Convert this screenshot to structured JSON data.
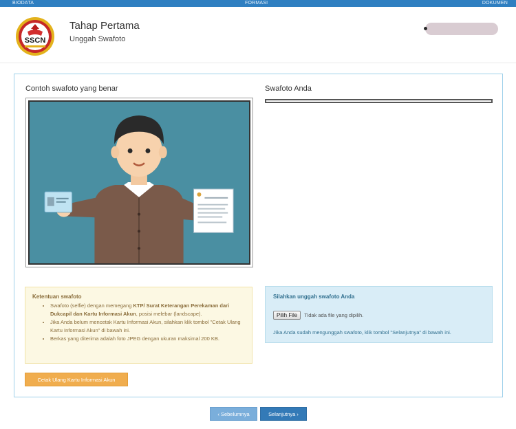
{
  "steps": [
    "BIODATA",
    "FORMASI",
    "DOKUMEN"
  ],
  "header": {
    "logo_text": "SSCN",
    "title": "Tahap Pertama",
    "subtitle": "Unggah Swafoto"
  },
  "main": {
    "example_label": "Contoh swafoto yang benar",
    "your_selfie_label": "Swafoto Anda",
    "rules": {
      "title": "Ketentuan swafoto",
      "item1_a": "Swafoto (selfie) dengan memegang ",
      "item1_b": "KTP/ Surat Keterangan Perekaman dari Dukcapil dan Kartu Informasi Akun",
      "item1_c": ", posisi melebar (landscape).",
      "item2": "Jika Anda belum mencetak Kartu Informasi Akun, silahkan klik tombol \"Cetak Ulang Kartu Informasi Akun\" di bawah ini.",
      "item3": "Berkas yang diterima adalah foto JPEG dengan ukuran maksimal 200 KB."
    },
    "upload": {
      "title": "Silahkan unggah swafoto Anda",
      "choose_file": "Pilih File",
      "no_file": "Tidak ada file yang dipilih.",
      "hint": "Jika Anda sudah mengunggah swafoto, klik tombol \"Selanjutnya\" di bawah ini."
    },
    "reprint_button": "Cetak Ulang Kartu Informasi Akun"
  },
  "nav": {
    "prev": "‹ Sebelumnya",
    "next": "Selanjutnya ›"
  },
  "colors": {
    "primary": "#337ab7",
    "warning": "#f0ad4e",
    "info_bg": "#d9edf7",
    "rules_bg": "#fcf8e3"
  }
}
